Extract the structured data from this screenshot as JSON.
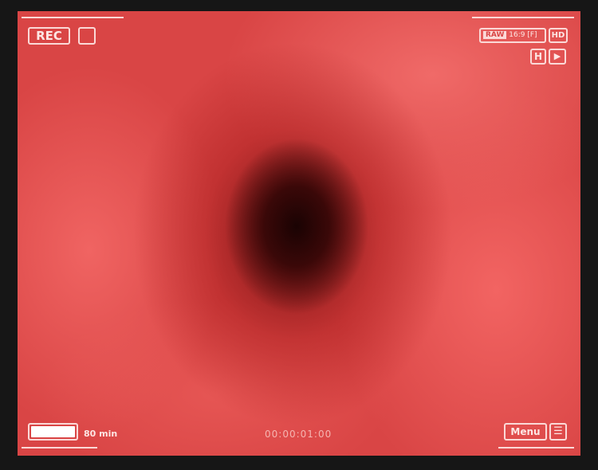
{
  "top_left": {
    "rec_label": "REC"
  },
  "top_right": {
    "raw_label": "RAW",
    "aspect_label": "16:9 [F]",
    "quality_label": "HD"
  },
  "bottom_left": {
    "battery_level": 1.0,
    "battery_text": "80 min"
  },
  "bottom_center": {
    "timecode": "00:00:01:00"
  },
  "bottom_right": {
    "menu_label": "Menu"
  }
}
